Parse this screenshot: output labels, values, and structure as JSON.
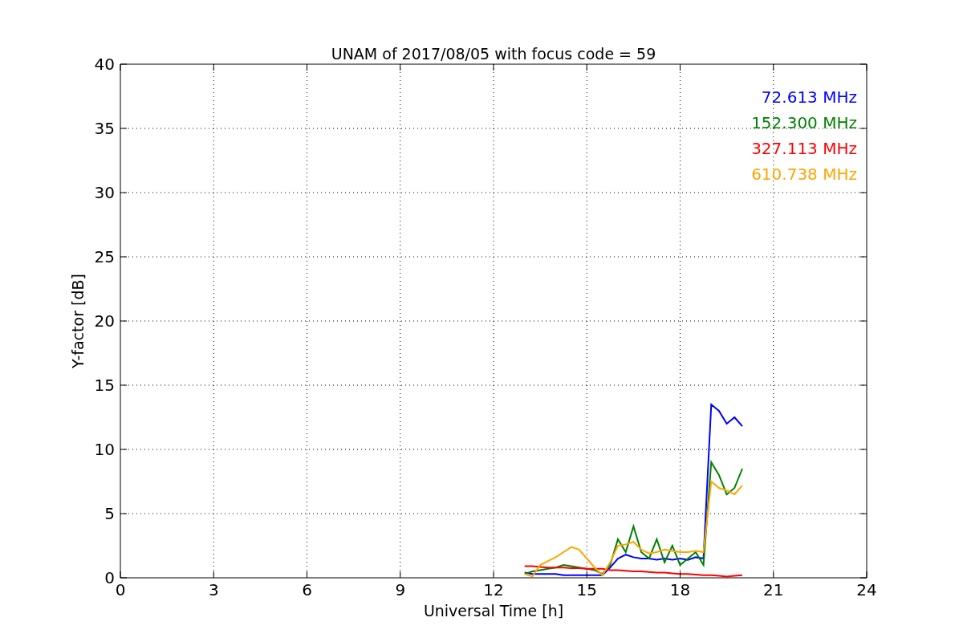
{
  "figure": {
    "chart_data": {
      "type": "line",
      "title": "UNAM of 2017/08/05 with focus code = 59",
      "xlabel": "Universal Time [h]",
      "ylabel": "Y-factor [dB]",
      "x": [
        13,
        13.25,
        13.5,
        13.75,
        14,
        14.25,
        14.5,
        14.75,
        15,
        15.25,
        15.5,
        15.75,
        16,
        16.25,
        16.5,
        16.75,
        17,
        17.25,
        17.5,
        17.75,
        18,
        18.25,
        18.5,
        18.75,
        19,
        19.25,
        19.5,
        19.75,
        20
      ],
      "series": [
        {
          "name": "72.613 MHz",
          "color": "#0000ff",
          "values": [
            0.4,
            0.3,
            0.3,
            0.3,
            0.3,
            0.2,
            0.2,
            0.2,
            0.2,
            0.2,
            0.2,
            0.8,
            1.5,
            1.8,
            1.6,
            1.5,
            1.5,
            1.4,
            1.5,
            1.4,
            1.5,
            1.4,
            1.6,
            1.5,
            13.5,
            13.0,
            12.0,
            12.5,
            11.8
          ]
        },
        {
          "name": "152.300 MHz",
          "color": "#008000",
          "values": [
            0.3,
            0.5,
            0.6,
            0.7,
            0.8,
            1.0,
            0.9,
            0.8,
            0.7,
            0.6,
            0.3,
            1.0,
            3.0,
            2.0,
            4.0,
            2.0,
            1.5,
            3.0,
            1.2,
            2.5,
            1.0,
            1.5,
            2.0,
            1.0,
            9.0,
            8.0,
            6.5,
            7.0,
            8.5
          ]
        },
        {
          "name": "327.113 MHz",
          "color": "#ff0000",
          "values": [
            0.9,
            0.9,
            0.85,
            0.8,
            0.8,
            0.8,
            0.75,
            0.75,
            0.7,
            0.7,
            0.7,
            0.6,
            0.6,
            0.55,
            0.5,
            0.5,
            0.45,
            0.4,
            0.4,
            0.35,
            0.3,
            0.3,
            0.25,
            0.2,
            0.2,
            0.15,
            0.1,
            0.15,
            0.2
          ]
        },
        {
          "name": "610.738 MHz",
          "color": "#ffa500",
          "values": [
            0.3,
            0.1,
            1.0,
            1.3,
            1.6,
            2.0,
            2.4,
            2.2,
            1.5,
            0.8,
            0.2,
            1.2,
            2.5,
            2.6,
            2.8,
            2.2,
            1.9,
            2.0,
            2.2,
            2.1,
            2.0,
            2.0,
            2.1,
            2.0,
            7.5,
            7.0,
            6.8,
            6.5,
            7.2
          ]
        }
      ],
      "xlim": [
        0,
        24
      ],
      "ylim": [
        0,
        40
      ],
      "grid": true,
      "xticks": [
        0,
        3,
        6,
        9,
        12,
        15,
        18,
        21,
        24
      ],
      "yticks": [
        0,
        5,
        10,
        15,
        20,
        25,
        30,
        35,
        40
      ]
    }
  }
}
